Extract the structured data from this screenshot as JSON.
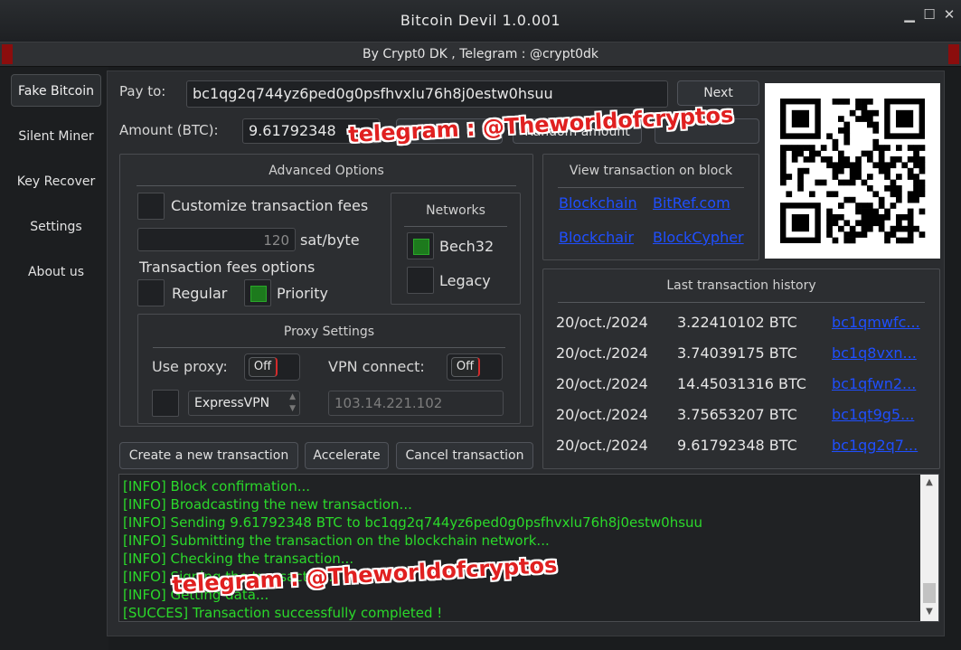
{
  "window": {
    "title": "Bitcoin Devil  1.0.001",
    "subtitle": "By Crypt0 DK , Telegram : @crypt0dk",
    "controls": [
      "minimize-icon",
      "maximize-icon",
      "close-icon"
    ]
  },
  "sidebar": {
    "items": [
      {
        "label": "Fake Bitcoin",
        "active": true
      },
      {
        "label": "Silent Miner"
      },
      {
        "label": "Key Recover"
      },
      {
        "label": "Settings"
      },
      {
        "label": "About us"
      }
    ]
  },
  "payment": {
    "pay_to_label": "Pay to:",
    "pay_to_value": "bc1qg2q744yz6ped0g0psfhvxlu76h8j0estw0hsuu",
    "next_label": "Next",
    "amount_label": "Amount (BTC):",
    "amount_value": "9.61792348",
    "random_amount_label": "Random amount"
  },
  "advanced": {
    "title": "Advanced Options",
    "customize_fees_label": "Customize transaction fees",
    "fee_value": "120",
    "fee_unit": "sat/byte",
    "fee_options_label": "Transaction fees options",
    "regular_label": "Regular",
    "priority_label": "Priority",
    "networks": {
      "title": "Networks",
      "bech32_label": "Bech32",
      "legacy_label": "Legacy"
    },
    "proxy": {
      "title": "Proxy Settings",
      "use_proxy_label": "Use proxy:",
      "use_proxy_state": "Off",
      "vpn_label": "VPN connect:",
      "vpn_state": "Off",
      "vpn_provider": "ExpressVPN",
      "ip_value": "103.14.221.102"
    }
  },
  "actions": {
    "create_label": "Create a new transaction",
    "accelerate_label": "Accelerate",
    "cancel_label": "Cancel transaction"
  },
  "view_block": {
    "title": "View transaction on block",
    "links": [
      "Blockchain",
      "BitRef.com",
      "Blockchair",
      "BlockCypher"
    ]
  },
  "history": {
    "title": "Last transaction history",
    "rows": [
      {
        "date": "20/oct./2024",
        "amount": "3.22410102 BTC",
        "tx": "bc1qmwfc..."
      },
      {
        "date": "20/oct./2024",
        "amount": "3.74039175 BTC",
        "tx": "bc1q8vxn..."
      },
      {
        "date": "20/oct./2024",
        "amount": "14.45031316 BTC",
        "tx": "bc1qfwn2..."
      },
      {
        "date": "20/oct./2024",
        "amount": "3.75653207 BTC",
        "tx": "bc1qt9g5..."
      },
      {
        "date": "20/oct./2024",
        "amount": "9.61792348 BTC",
        "tx": "bc1qg2q7..."
      }
    ]
  },
  "console": {
    "lines": [
      "[INFO]  Block confirmation...",
      "[INFO]  Broadcasting the new transaction...",
      "[INFO]  Sending 9.61792348 BTC to bc1qg2q744yz6ped0g0psfhvxlu76h8j0estw0hsuu",
      "[INFO]  Submitting the transaction on the blockchain network...",
      "[INFO]  Checking the transaction...",
      "[INFO]  Signing the transaction...",
      "[INFO]  Getting data...",
      "[SUCCES]  Transaction successfully completed !"
    ]
  },
  "watermark": {
    "text": "telegram : @Theworldofcryptos"
  },
  "colors": {
    "log_green": "#2bd92b",
    "link_blue": "#1f4fff",
    "toggle_red": "#d42b2b",
    "check_green": "#1d7a1d",
    "watermark_red": "#e02020"
  }
}
